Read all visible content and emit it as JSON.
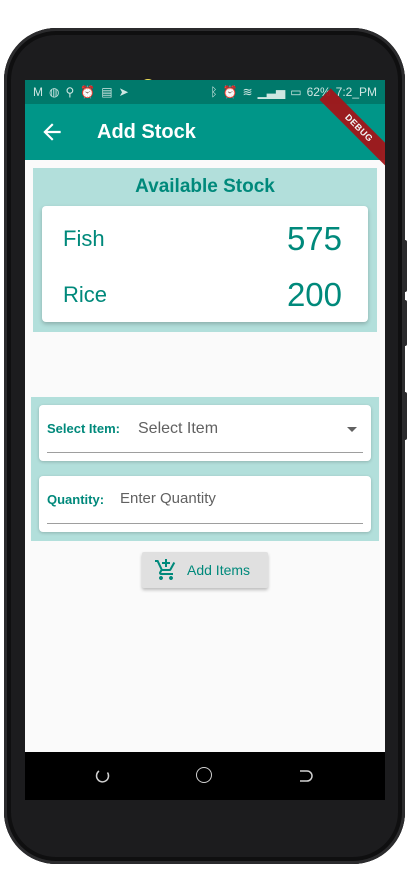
{
  "status_bar": {
    "left_icons": [
      "gmail-icon",
      "circle-icon",
      "location-icon",
      "alarm-icon",
      "calendar-icon",
      "send-icon"
    ],
    "right_icons": [
      "bluetooth-icon",
      "alarm-icon",
      "wifi-icon",
      "signal-icon",
      "signal-icon",
      "battery-icon"
    ],
    "battery": "62%",
    "time": "7:2_PM"
  },
  "app_bar": {
    "title": "Add Stock",
    "debug_banner": "DEBUG"
  },
  "available_stock": {
    "title": "Available Stock",
    "items": [
      {
        "name": "Fish",
        "quantity": "575"
      },
      {
        "name": "Rice",
        "quantity": "200"
      }
    ]
  },
  "form": {
    "select_item_label": "Select Item:",
    "select_item_value": "Select Item",
    "quantity_label": "Quantity:",
    "quantity_placeholder": "Enter Quantity"
  },
  "actions": {
    "add_items_label": "Add Items",
    "add_items_icon": "add-shopping-cart-icon"
  },
  "colors": {
    "primary": "#009688",
    "primary_dark": "#00796b",
    "accent_text": "#00897b",
    "panel_bg": "#b2dfdb"
  }
}
